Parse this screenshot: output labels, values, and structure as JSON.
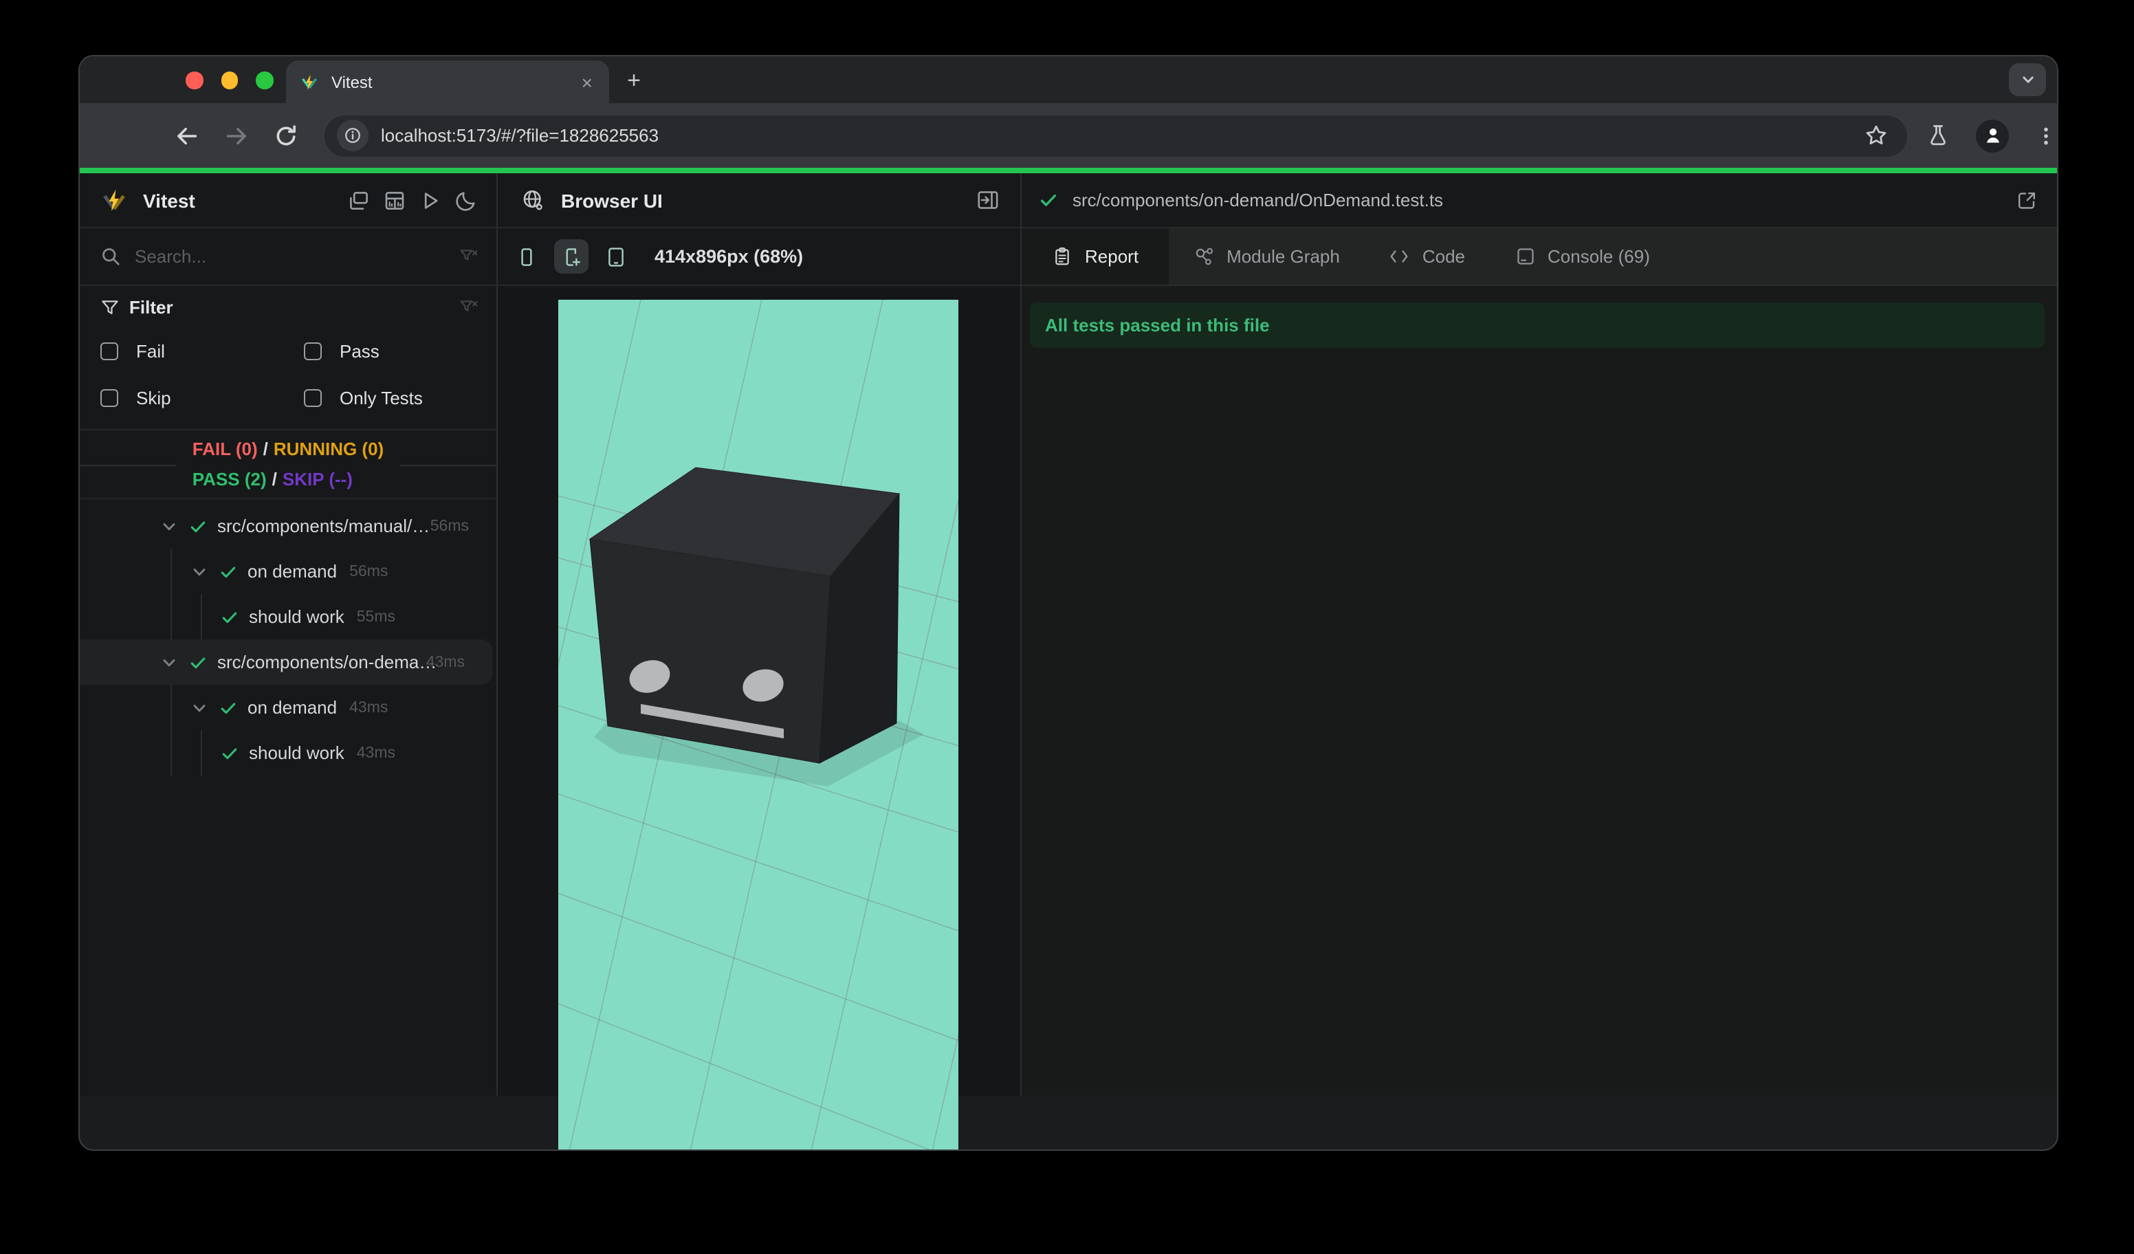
{
  "browser": {
    "tab_title": "Vitest",
    "close_tab_label": "×",
    "new_tab_label": "+",
    "url": "localhost:5173/#/?file=1828625563"
  },
  "sidebar": {
    "app_title": "Vitest",
    "search_placeholder": "Search...",
    "filter": {
      "title": "Filter",
      "options": [
        "Fail",
        "Pass",
        "Skip",
        "Only Tests"
      ]
    },
    "summary": {
      "fail": "FAIL (0)",
      "sep1": "/",
      "running": "RUNNING (0)",
      "pass": "PASS (2)",
      "sep2": "/",
      "skip": "SKIP (--)"
    },
    "tree": [
      {
        "label": "src/components/manual/…",
        "time": "56ms",
        "level": 0,
        "kind": "file",
        "chevron": true,
        "time_right": true,
        "selected": false
      },
      {
        "label": "on demand",
        "time": "56ms",
        "level": 1,
        "kind": "suite",
        "chevron": true,
        "time_right": false,
        "selected": false
      },
      {
        "label": "should work",
        "time": "55ms",
        "level": 2,
        "kind": "test",
        "chevron": false,
        "time_right": false,
        "selected": false
      },
      {
        "label": "src/components/on-dema…",
        "time": "43ms",
        "level": 0,
        "kind": "file",
        "chevron": true,
        "time_right": true,
        "selected": true
      },
      {
        "label": "on demand",
        "time": "43ms",
        "level": 1,
        "kind": "suite",
        "chevron": true,
        "time_right": false,
        "selected": false
      },
      {
        "label": "should work",
        "time": "43ms",
        "level": 2,
        "kind": "test",
        "chevron": false,
        "time_right": false,
        "selected": false
      }
    ]
  },
  "browser_panel": {
    "title": "Browser UI",
    "viewport_label": "414x896px (68%)"
  },
  "report_panel": {
    "file_path": "src/components/on-demand/OnDemand.test.ts",
    "tabs": [
      {
        "label": "Report",
        "icon": "clipboard-icon",
        "active": true
      },
      {
        "label": "Module Graph",
        "icon": "module-graph-icon",
        "active": false
      },
      {
        "label": "Code",
        "icon": "code-icon",
        "active": false
      },
      {
        "label": "Console (69)",
        "icon": "console-icon",
        "active": false
      }
    ],
    "banner": "All tests passed in this file"
  },
  "colors": {
    "progress_green": "#23c552",
    "check_green": "#2fbb72",
    "fail_red": "#f56060",
    "running_amber": "#dfa114",
    "pass_green": "#2ec06d",
    "skip_purple": "#7239c7",
    "viewport_mint": "#85dcc4",
    "banner_green": "#3dbb78",
    "banner_bg": "#15291d",
    "traffic_red": "#ff5f57",
    "traffic_yellow": "#febc2e",
    "traffic_green": "#28c840"
  }
}
